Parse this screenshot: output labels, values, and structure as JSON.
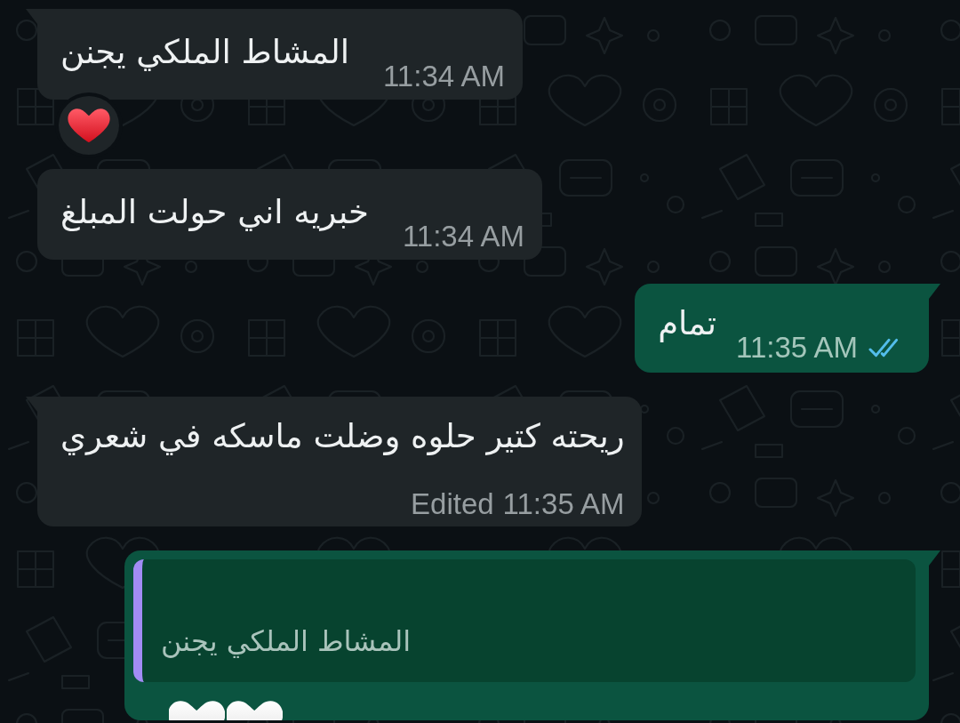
{
  "messages": [
    {
      "kind": "incoming",
      "tail": true,
      "text": "المشاط الملكي يجنن",
      "time": "11:34 AM",
      "reacted": true
    },
    {
      "kind": "incoming",
      "tail": false,
      "text": "خبريه اني حولت المبلغ",
      "time": "11:34 AM",
      "reacted": false
    },
    {
      "kind": "outgoing",
      "tail": true,
      "text": "تمام",
      "time": "11:35 AM",
      "read": true,
      "reacted": false
    },
    {
      "kind": "incoming",
      "tail": true,
      "text": "ريحته كتير حلوه وضلت ماسكه في شعري",
      "edited_label": "Edited",
      "time": "11:35 AM",
      "reacted": false
    },
    {
      "kind": "outgoing",
      "tail": true,
      "quote": {
        "text": "المشاط الملكي يجنن"
      },
      "reacted": false
    }
  ]
}
